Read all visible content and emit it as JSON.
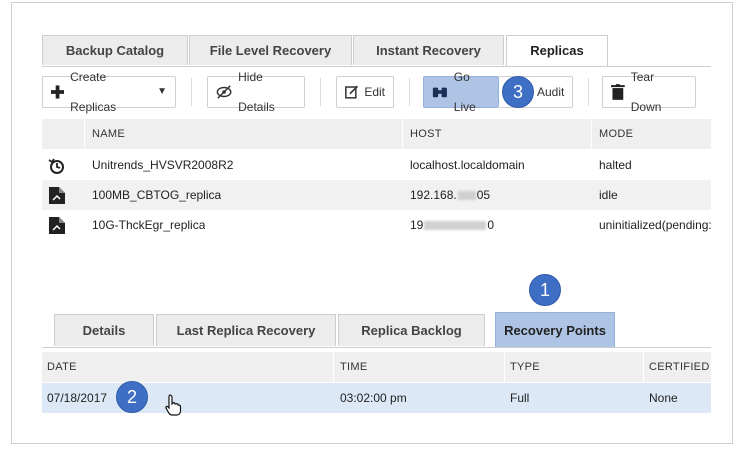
{
  "top_tabs": [
    "Backup Catalog",
    "File Level Recovery",
    "Instant Recovery",
    "Replicas"
  ],
  "toolbar": {
    "create": "Create Replicas",
    "hide": "Hide Details",
    "edit": "Edit",
    "golive": "Go Live",
    "audit": "Audit",
    "teardown": "Tear Down"
  },
  "callouts": {
    "c1": "1",
    "c2": "2",
    "c3": "3"
  },
  "replicas": {
    "columns": [
      "NAME",
      "HOST",
      "MODE"
    ],
    "rows": [
      {
        "name": "Unitrends_HVSVR2008R2",
        "host": "localhost.localdomain",
        "mode": "halted",
        "icon": "restore-icon"
      },
      {
        "name": "100MB_CBTOG_replica",
        "host_prefix": "192.168.",
        "host_suffix": "05",
        "mode": "idle",
        "icon": "replica-doc-icon"
      },
      {
        "name": "10G-ThckEgr_replica",
        "host_prefix": "19",
        "host_suffix": "0",
        "mode": "uninitialized(pending:",
        "icon": "replica-doc-icon"
      }
    ]
  },
  "lower_tabs": [
    "Details",
    "Last Replica Recovery",
    "Replica Backlog",
    "Recovery Points"
  ],
  "points": {
    "columns": [
      "DATE",
      "TIME",
      "TYPE",
      "CERTIFIED"
    ],
    "rows": [
      {
        "date": "07/18/2017",
        "time": "03:02:00 pm",
        "type": "Full",
        "certified": "None"
      }
    ]
  },
  "colors": {
    "highlight": "#aec4e4",
    "callout": "#3f6fc4",
    "selected_row": "#dce8f6"
  }
}
